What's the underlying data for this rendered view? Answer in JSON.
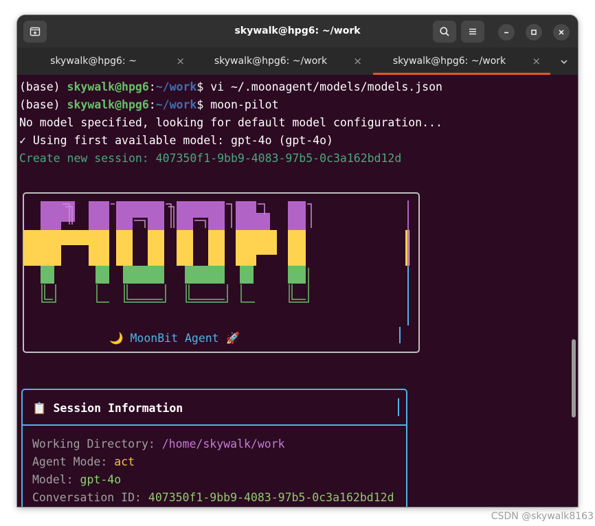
{
  "window": {
    "title": "skywalk@hpg6: ~/work"
  },
  "titlebar": {
    "new_tab_icon": "new-tab-icon",
    "search_icon": "search-icon",
    "menu_icon": "hamburger-menu-icon",
    "minimize": "–",
    "maximize": "□",
    "close": "✕"
  },
  "tabs": [
    {
      "label": "skywalk@hpg6: ~",
      "close": "×",
      "active": false
    },
    {
      "label": "skywalk@hpg6: ~/work",
      "close": "×",
      "active": false
    },
    {
      "label": "skywalk@hpg6: ~/work",
      "close": "×",
      "active": true
    }
  ],
  "tab_menu": "⌄",
  "terminal": {
    "lines": [
      {
        "prefix": "(base) ",
        "user": "skywalk@hpg6",
        "colon": ":",
        "path": "~/work",
        "dollar": "$ ",
        "cmd": "vi ~/.moonagent/models/models.json"
      },
      {
        "prefix": "(base) ",
        "user": "skywalk@hpg6",
        "colon": ":",
        "path": "~/work",
        "dollar": "$ ",
        "cmd": "moon-pilot"
      }
    ],
    "output": [
      "No model specified, looking for default model configuration...",
      "✓ Using first available model: gpt-4o (gpt-4o)",
      "Create new session: 407350f1-9bb9-4083-97b5-0c3a162bd12d"
    ],
    "banner": {
      "ascii_word": "MOON",
      "label": "🌙 MoonBit Agent 🚀",
      "colors": {
        "purple": "#b264c6",
        "yellow": "#ffd34f",
        "green": "#6abd6a"
      }
    },
    "session": {
      "header": "📋 Session Information",
      "rows": [
        {
          "key": "Working Directory: ",
          "value": "/home/skywalk/work"
        },
        {
          "key": "Agent Mode: ",
          "value": "act"
        },
        {
          "key": "Model: ",
          "value": "gpt-4o"
        },
        {
          "key": "Conversation ID: ",
          "value": "407350f1-9bb9-4083-97b5-0c3a162bd12d"
        }
      ]
    }
  },
  "watermark": "CSDN @skywalk8163"
}
